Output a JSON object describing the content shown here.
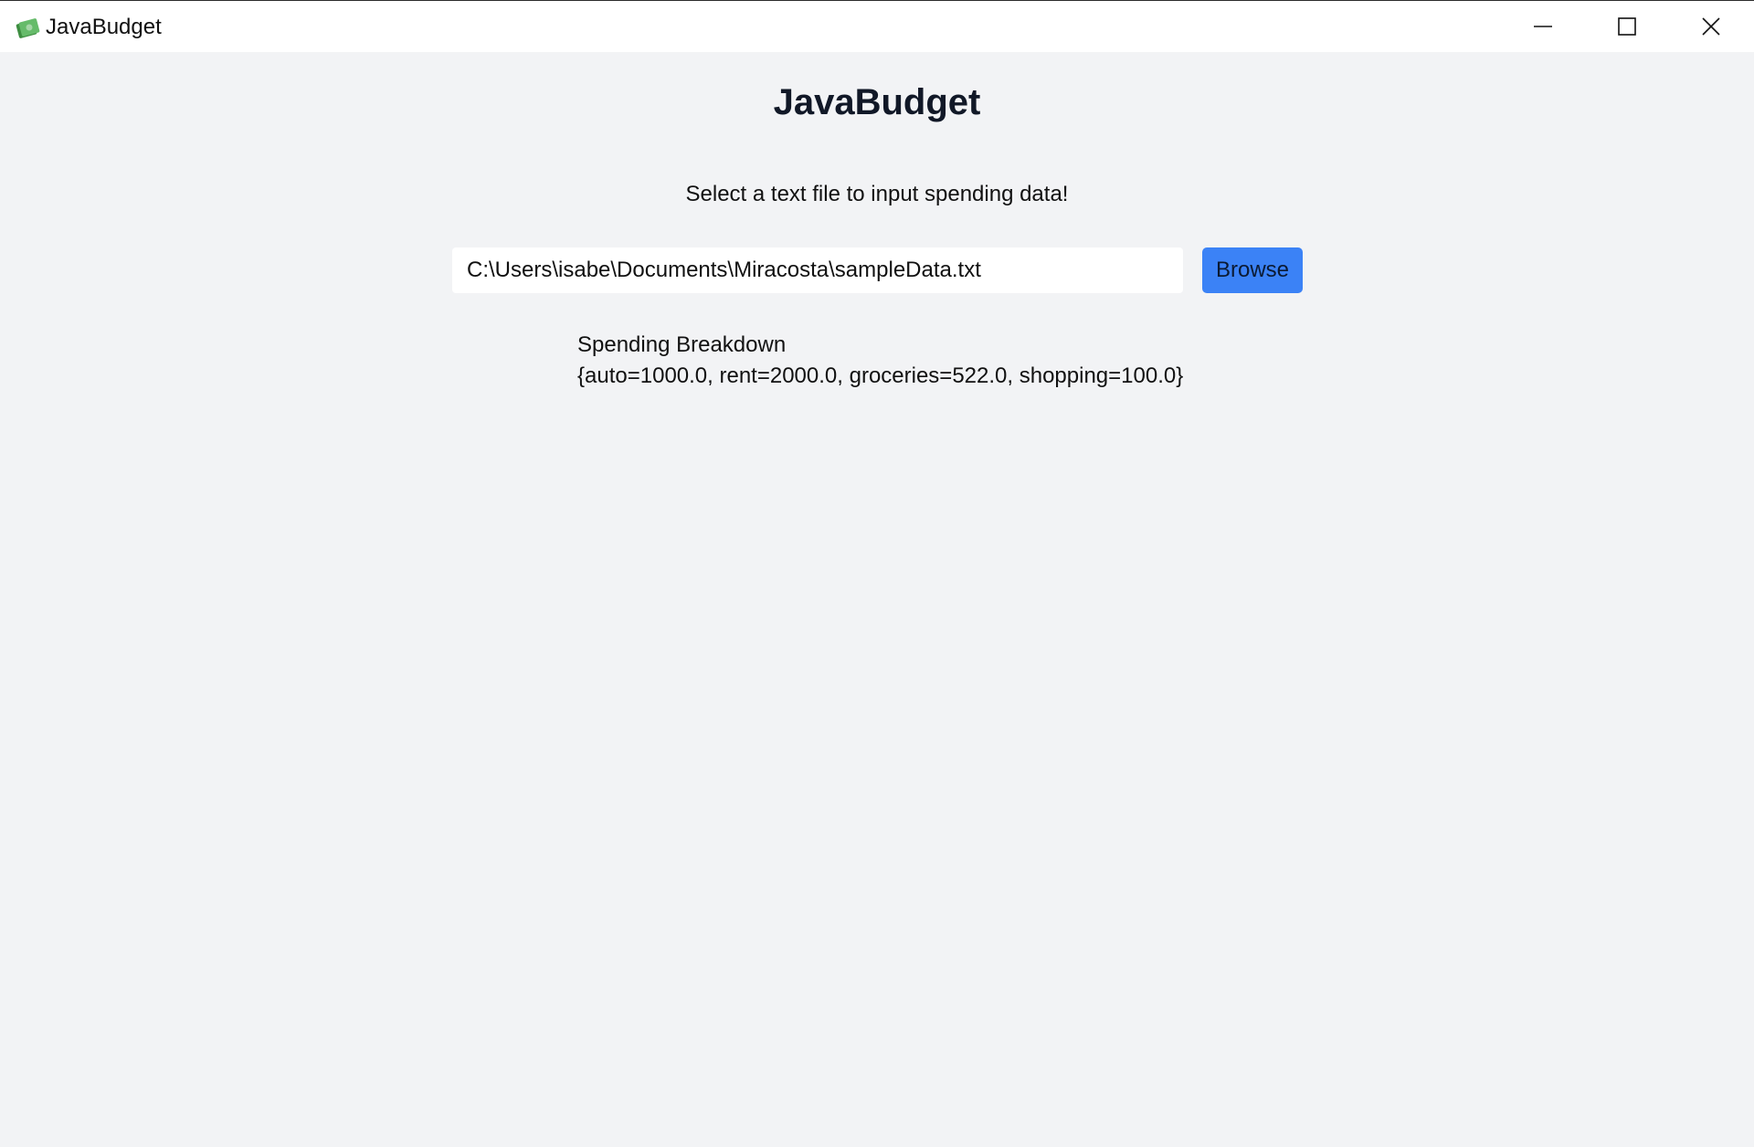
{
  "window": {
    "title": "JavaBudget",
    "icon": "money-bills-icon",
    "controls": [
      "minimize-icon",
      "maximize-icon",
      "close-icon"
    ]
  },
  "main": {
    "heading": "JavaBudget",
    "prompt": "Select a text file to input spending data!",
    "file_path": "C:\\Users\\isabe\\Documents\\Miracosta\\sampleData.txt",
    "browse_label": "Browse",
    "breakdown_title": "Spending Breakdown",
    "breakdown_values": "{auto=1000.0, rent=2000.0, groceries=522.0, shopping=100.0}"
  },
  "colors": {
    "background": "#f2f3f5",
    "titlebar": "#ffffff",
    "accent": "#3b82f6",
    "icon_green": "#4caf50"
  }
}
